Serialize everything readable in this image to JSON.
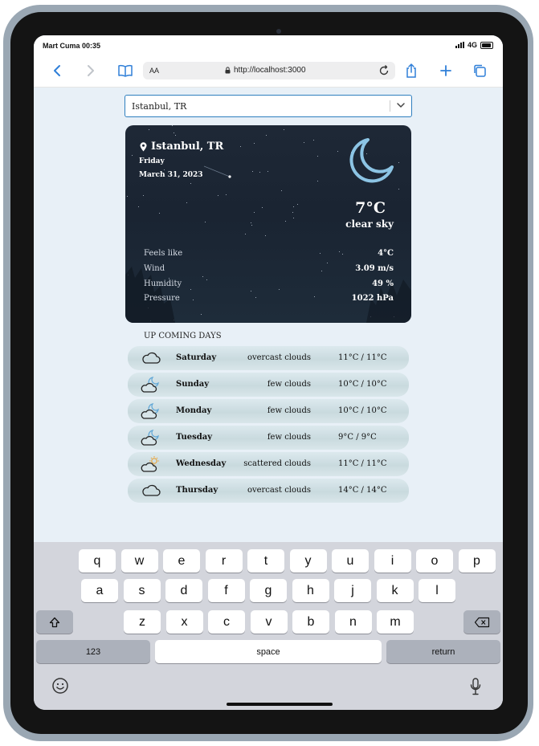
{
  "status": {
    "carrier_time": "Mart Cuma 00:35",
    "network": "4G"
  },
  "browser": {
    "reader_label": "AA",
    "url": "http://localhost:3000",
    "icons": [
      "back-icon",
      "forward-icon",
      "book-icon",
      "lock-icon",
      "reload-icon",
      "share-icon",
      "plus-icon",
      "tabs-icon"
    ]
  },
  "city_select": {
    "value": "Istanbul, TR"
  },
  "current": {
    "location": "Istanbul, TR",
    "day": "Friday",
    "date": "March 31, 2023",
    "temperature": "7°C",
    "condition": "clear sky",
    "icon": "moon-icon",
    "details": [
      {
        "label": "Feels like",
        "value": "4°C"
      },
      {
        "label": "Wind",
        "value": "3.09 m/s"
      },
      {
        "label": "Humidity",
        "value": "49 %"
      },
      {
        "label": "Pressure",
        "value": "1022 hPa"
      }
    ]
  },
  "upcoming": {
    "title": "UP COMING DAYS",
    "days": [
      {
        "day": "Saturday",
        "description": "overcast clouds",
        "temps": "11°C / 11°C",
        "icon": "cloud-icon"
      },
      {
        "day": "Sunday",
        "description": "few clouds",
        "temps": "10°C / 10°C",
        "icon": "cloud-moon-icon"
      },
      {
        "day": "Monday",
        "description": "few clouds",
        "temps": "10°C / 10°C",
        "icon": "cloud-moon-icon"
      },
      {
        "day": "Tuesday",
        "description": "few clouds",
        "temps": "9°C / 9°C",
        "icon": "cloud-moon-icon"
      },
      {
        "day": "Wednesday",
        "description": "scattered clouds",
        "temps": "11°C / 11°C",
        "icon": "cloud-sun-icon"
      },
      {
        "day": "Thursday",
        "description": "overcast clouds",
        "temps": "14°C / 14°C",
        "icon": "cloud-icon"
      }
    ]
  },
  "keyboard": {
    "row1": [
      "q",
      "w",
      "e",
      "r",
      "t",
      "y",
      "u",
      "i",
      "o",
      "p"
    ],
    "row2": [
      "a",
      "s",
      "d",
      "f",
      "g",
      "h",
      "j",
      "k",
      "l"
    ],
    "row3": [
      "z",
      "x",
      "c",
      "v",
      "b",
      "n",
      "m"
    ],
    "numbers_label": "123",
    "space_label": "space",
    "return_label": "return"
  },
  "colors": {
    "accent": "#3a7bd5",
    "card_bg": "#1e2836",
    "forecast_row": "#d4e3e7",
    "moon": "#8cc4e4"
  }
}
